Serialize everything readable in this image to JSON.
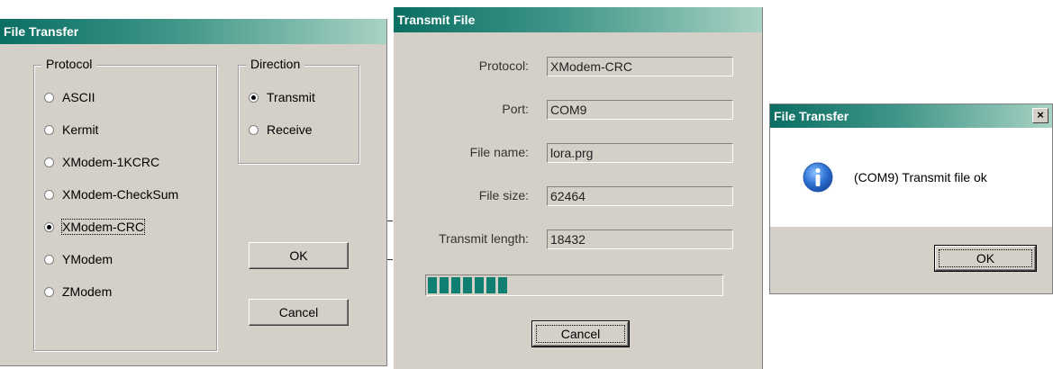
{
  "file_transfer_dialog": {
    "title": "File Transfer",
    "protocol_group_label": "Protocol",
    "protocols": [
      "ASCII",
      "Kermit",
      "XModem-1KCRC",
      "XModem-CheckSum",
      "XModem-CRC",
      "YModem",
      "ZModem"
    ],
    "selected_protocol": "XModem-CRC",
    "direction_group_label": "Direction",
    "directions": [
      "Transmit",
      "Receive"
    ],
    "selected_direction": "Transmit",
    "ok_label": "OK",
    "cancel_label": "Cancel"
  },
  "transmit_dialog": {
    "title": "Transmit File",
    "fields": [
      {
        "label": "Protocol:",
        "value": "XModem-CRC"
      },
      {
        "label": "Port:",
        "value": "COM9"
      },
      {
        "label": "File name:",
        "value": "lora.prg"
      },
      {
        "label": "File size:",
        "value": "62464"
      },
      {
        "label": "Transmit length:",
        "value": "18432"
      }
    ],
    "progress_fraction": 0.295,
    "cancel_label": "Cancel"
  },
  "message_box": {
    "title": "File Transfer",
    "message": "(COM9) Transmit file ok",
    "icon": "info-icon",
    "close_label": "×",
    "ok_label": "OK"
  },
  "colors": {
    "titlebar_start": "#0b6e63",
    "titlebar_end": "#a8d2c4",
    "progress_block": "#0e7f71",
    "dialog_face": "#d4d0c8"
  }
}
